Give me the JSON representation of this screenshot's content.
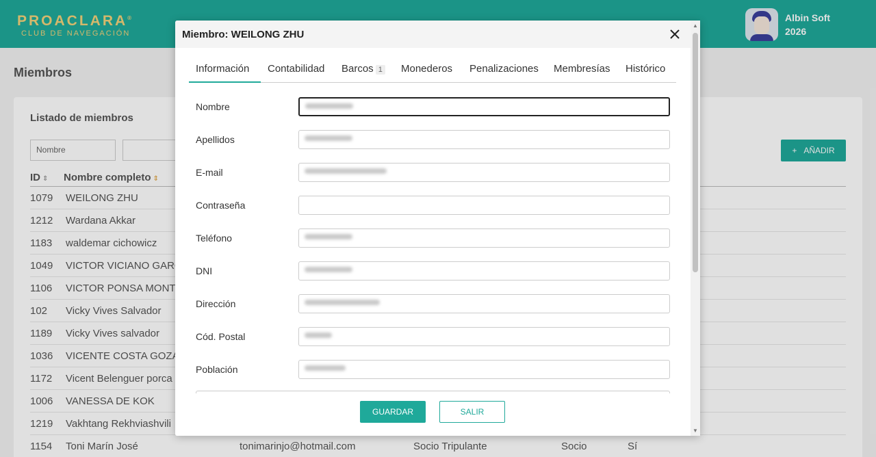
{
  "header": {
    "brand_name": "PROACLARA",
    "brand_reg": "®",
    "brand_sub": "CLUB DE NAVEGACIÓN",
    "user_name": "Albin Soft",
    "user_year": "2026"
  },
  "page": {
    "title": "Miembros",
    "panel_title": "Listado de miembros",
    "filter_nombre_placeholder": "Nombre",
    "add_button": "AÑADIR",
    "columns": [
      "ID",
      "Nombre completo"
    ],
    "rows": [
      {
        "id": "1079",
        "name": "WEILONG ZHU",
        "email": "",
        "type": "",
        "role": "",
        "active": ""
      },
      {
        "id": "1212",
        "name": "Wardana Akkar",
        "email": "",
        "type": "",
        "role": "",
        "active": ""
      },
      {
        "id": "1183",
        "name": "waldemar cichowicz",
        "email": "",
        "type": "",
        "role": "",
        "active": ""
      },
      {
        "id": "1049",
        "name": "VICTOR VICIANO GARC",
        "email": "",
        "type": "",
        "role": "",
        "active": ""
      },
      {
        "id": "1106",
        "name": "VICTOR PONSA MONTE",
        "email": "",
        "type": "",
        "role": "",
        "active": ""
      },
      {
        "id": "102",
        "name": "Vicky Vives Salvador",
        "email": "",
        "type": "",
        "role": "",
        "active": ""
      },
      {
        "id": "1189",
        "name": "Vicky Vives salvador",
        "email": "",
        "type": "",
        "role": "",
        "active": ""
      },
      {
        "id": "1036",
        "name": "VICENTE COSTA GOZAL",
        "email": "",
        "type": "",
        "role": "",
        "active": ""
      },
      {
        "id": "1172",
        "name": "Vicent Belenguer porca",
        "email": "",
        "type": "",
        "role": "",
        "active": ""
      },
      {
        "id": "1006",
        "name": "VANESSA DE KOK",
        "email": "",
        "type": "",
        "role": "",
        "active": ""
      },
      {
        "id": "1219",
        "name": "Vakhtang Rekhviashvili",
        "email": "",
        "type": "",
        "role": "",
        "active": ""
      },
      {
        "id": "1154",
        "name": "Toni Marín José",
        "email": "tonimarinjo@hotmail.com",
        "type": "Socio Tripulante",
        "role": "Socio",
        "active": "Sí"
      }
    ]
  },
  "modal": {
    "title": "Miembro: WEILONG ZHU",
    "tabs": [
      {
        "label": "Información"
      },
      {
        "label": "Contabilidad"
      },
      {
        "label": "Barcos",
        "badge": "1"
      },
      {
        "label": "Monederos"
      },
      {
        "label": "Penalizaciones"
      },
      {
        "label": "Membresías"
      },
      {
        "label": "Histórico"
      }
    ],
    "fields": [
      {
        "label": "Nombre"
      },
      {
        "label": "Apellidos"
      },
      {
        "label": "E-mail"
      },
      {
        "label": "Contraseña"
      },
      {
        "label": "Teléfono"
      },
      {
        "label": "DNI"
      },
      {
        "label": "Dirección"
      },
      {
        "label": "Cód. Postal"
      },
      {
        "label": "Población"
      }
    ],
    "save_button": "GUARDAR",
    "exit_button": "SALIR"
  },
  "colors": {
    "accent": "#1fa99a",
    "brand_text": "#f2d27a",
    "sort_active": "#e0a84c"
  }
}
